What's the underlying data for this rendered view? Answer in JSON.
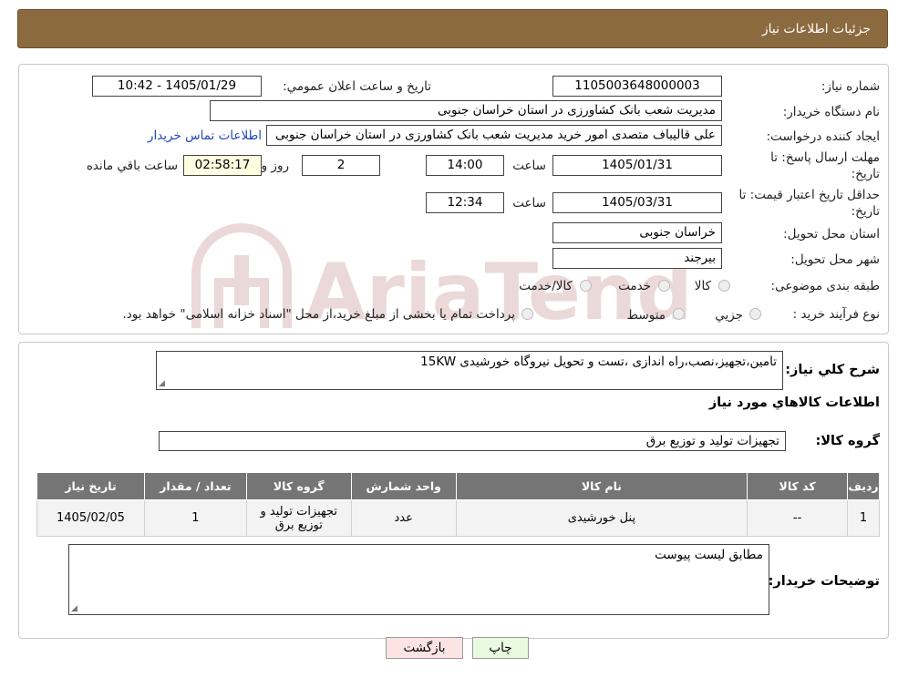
{
  "header": {
    "title": "جزئیات اطلاعات نیاز"
  },
  "info": {
    "need_number_label": "شماره نیاز:",
    "need_number": "1105003648000003",
    "announce_label": "تاریخ و ساعت اعلان عمومي:",
    "announce_value": "1405/01/29 - 10:42",
    "buyer_org_label": "نام دستگاه خریدار:",
    "buyer_org": "مدیریت شعب بانک کشاورزی در استان خراسان جنوبی",
    "requester_label": "ایجاد کننده درخواست:",
    "requester": "علی قالیباف متصدی امور خرید مدیریت شعب بانک کشاورزی در استان خراسان جنوبی",
    "contact_link": "اطلاعات تماس خریدار",
    "deadline_label_1": "مهلت ارسال پاسخ: تا",
    "deadline_label_2": "تاریخ:",
    "deadline_date": "1405/01/31",
    "time_word": "ساعت",
    "deadline_time": "14:00",
    "days_value": "2",
    "days_and": "روز و",
    "remaining_time": "02:58:17",
    "remaining_label": "ساعت باقي مانده",
    "validity_label_1": "حداقل تاریخ اعتبار قیمت: تا",
    "validity_label_2": "تاریخ:",
    "validity_date": "1405/03/31",
    "validity_time": "12:34",
    "province_label": "استان محل تحویل:",
    "province": "خراسان جنوبی",
    "city_label": "شهر محل تحویل:",
    "city": "بیرجند",
    "category_label": "طبقه بندی موضوعی:",
    "category_options": [
      "کالا",
      "خدمت",
      "کالا/خدمت"
    ],
    "process_label": "نوع فرآیند خرید :",
    "process_options": [
      "جزیي",
      "متوسط"
    ],
    "process_note": "پرداخت تمام یا بخشی از مبلغ خرید،از محل \"اسناد خزانه اسلامی\" خواهد بود."
  },
  "description": {
    "label": "شرح کلي نیاز:",
    "value": "تامین،تجهیز،نصب،راه اندازی ،تست و تحویل نیروگاه خورشیدی 15KW"
  },
  "goods": {
    "section_title": "اطلاعات کالاهاي مورد نیاز",
    "group_label": "گروه کالا:",
    "group_value": "تجهیزات تولید و توزیع برق"
  },
  "table": {
    "headers": [
      "ردیف",
      "کد کالا",
      "نام کالا",
      "واحد شمارش",
      "گروه کالا",
      "تعداد / مقدار",
      "تاریخ نیاز"
    ],
    "rows": [
      [
        "1",
        "--",
        "پنل خورشیدی",
        "عدد",
        "تجهیزات تولید و توزیع برق",
        "1",
        "1405/02/05"
      ]
    ]
  },
  "buyer_notes": {
    "label": "توضیحات خریدار:",
    "value": "مطابق لیست پیوست"
  },
  "buttons": {
    "back": "بازگشت",
    "print": "چاپ"
  },
  "watermark": {
    "text": "AriaTender.neT"
  },
  "colors": {
    "header_bg": "#8c6a3f",
    "table_header_bg": "#757575",
    "back_bg": "#fde4e4",
    "print_bg": "#e8fbe0",
    "link": "#1f47b5"
  }
}
